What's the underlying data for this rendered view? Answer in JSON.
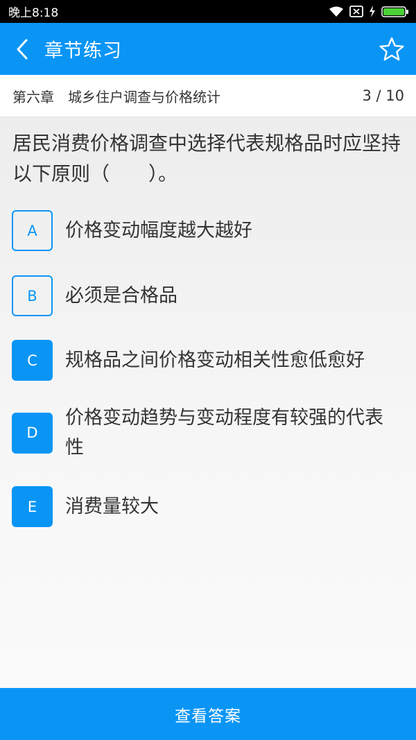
{
  "status_bar": {
    "time": "晚上8:18",
    "icons": [
      "wifi-icon",
      "sim-off-icon",
      "charging-icon",
      "battery-icon"
    ]
  },
  "app_bar": {
    "title": "章节练习",
    "back_icon": "chevron-left-icon",
    "favorite_icon": "star-outline-icon"
  },
  "chapter": {
    "title": "第六章　城乡住户调查与价格统计",
    "progress": "3 / 10"
  },
  "question": {
    "text": "居民消费价格调查中选择代表规格品时应坚持以下原则（　　）。"
  },
  "options": [
    {
      "letter": "A",
      "text": "价格变动幅度越大越好",
      "selected": false
    },
    {
      "letter": "B",
      "text": "必须是合格品",
      "selected": false
    },
    {
      "letter": "C",
      "text": "规格品之间价格变动相关性愈低愈好",
      "selected": true
    },
    {
      "letter": "D",
      "text": "价格变动趋势与变动程度有较强的代表性",
      "selected": true
    },
    {
      "letter": "E",
      "text": "消费量较大",
      "selected": true
    }
  ],
  "footer": {
    "answer_label": "查看答案"
  },
  "colors": {
    "accent": "#0a95f5",
    "text": "#333333"
  }
}
